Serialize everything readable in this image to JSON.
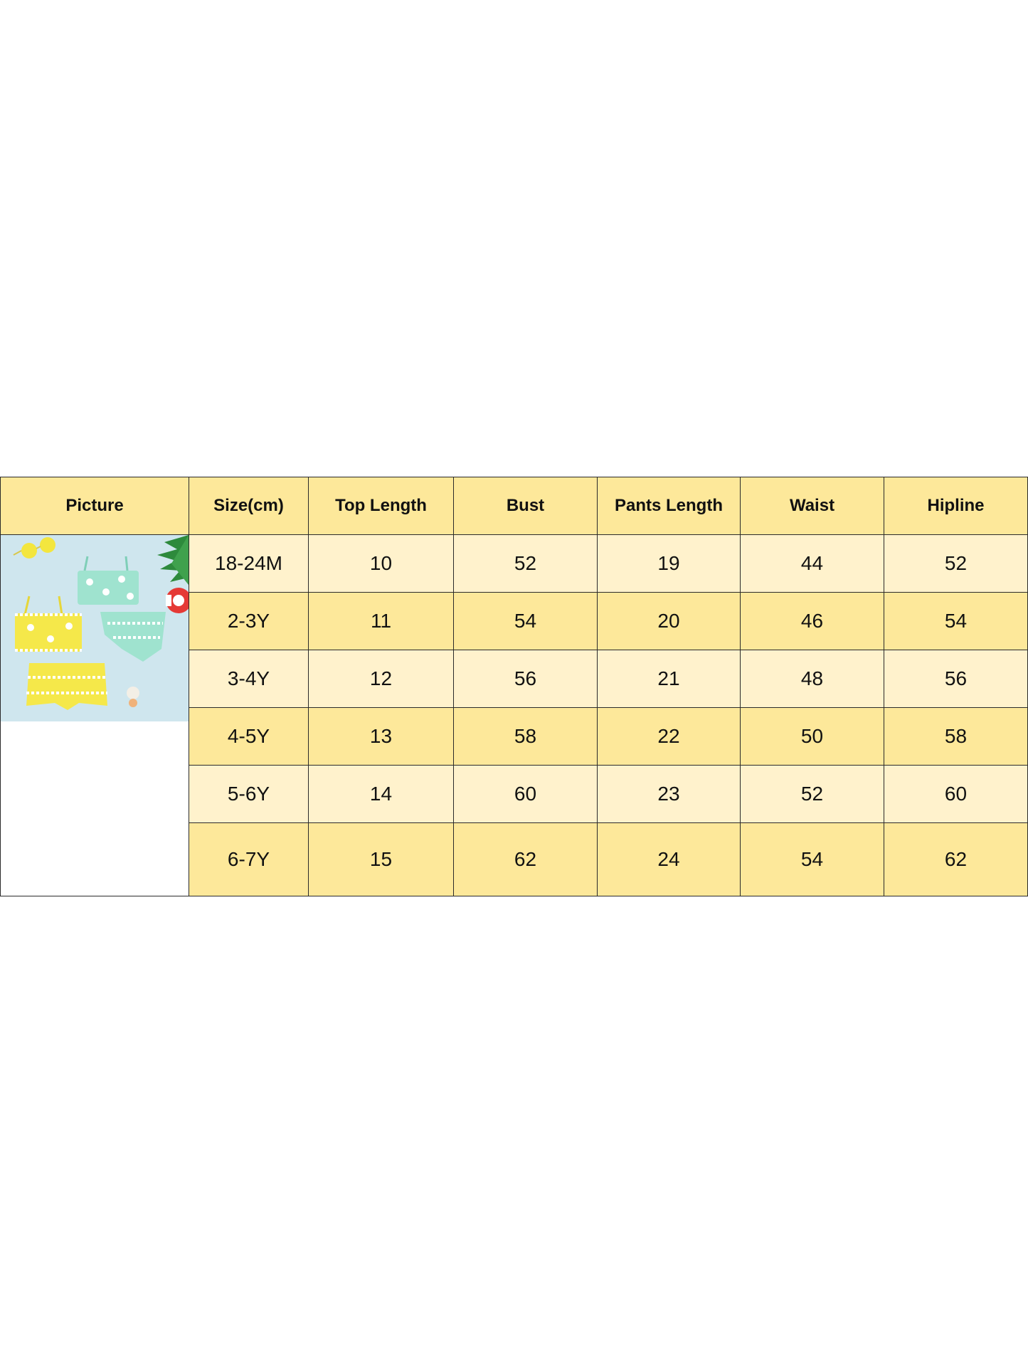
{
  "colors": {
    "header_bg": "#fde89a",
    "row_light": "#fff2cc",
    "row_dark": "#fde89a",
    "border": "#2a2a2a",
    "photo_bg": "#cfe6ee",
    "swim_yellow": "#f5e84a",
    "swim_mint": "#9fe3cf"
  },
  "table": {
    "headers": {
      "picture": "Picture",
      "size": "Size(cm)",
      "top_length": "Top Length",
      "bust": "Bust",
      "pants_length": "Pants Length",
      "waist": "Waist",
      "hipline": "Hipline"
    },
    "rows": [
      {
        "size": "18-24M",
        "top_length": "10",
        "bust": "52",
        "pants_length": "19",
        "waist": "44",
        "hipline": "52"
      },
      {
        "size": "2-3Y",
        "top_length": "11",
        "bust": "54",
        "pants_length": "20",
        "waist": "46",
        "hipline": "54"
      },
      {
        "size": "3-4Y",
        "top_length": "12",
        "bust": "56",
        "pants_length": "21",
        "waist": "48",
        "hipline": "56"
      },
      {
        "size": "4-5Y",
        "top_length": "13",
        "bust": "58",
        "pants_length": "22",
        "waist": "50",
        "hipline": "58"
      },
      {
        "size": "5-6Y",
        "top_length": "14",
        "bust": "60",
        "pants_length": "23",
        "waist": "52",
        "hipline": "60"
      },
      {
        "size": "6-7Y",
        "top_length": "15",
        "bust": "62",
        "pants_length": "24",
        "waist": "54",
        "hipline": "62"
      }
    ]
  },
  "product_image": {
    "icon": "swimsuit-product-photo"
  }
}
